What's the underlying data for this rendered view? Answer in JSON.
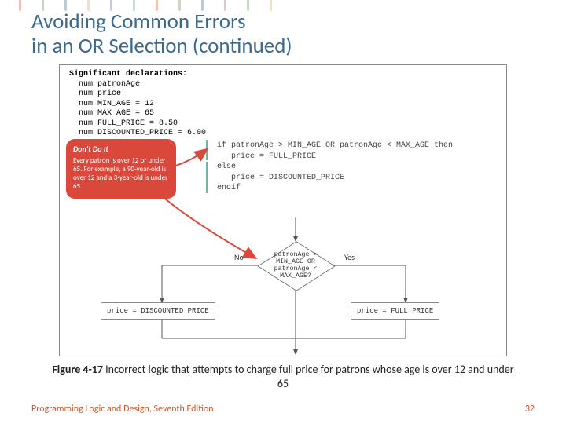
{
  "title_line1": "Avoiding Common Errors",
  "title_line2": "in an OR Selection (continued)",
  "decl": {
    "heading": "Significant declarations:",
    "l1": "num patronAge",
    "l2": "num price",
    "l3": "num MIN_AGE = 12",
    "l4": "num MAX_AGE = 65",
    "l5": "num FULL_PRICE = 8.50",
    "l6": "num DISCOUNTED_PRICE = 6.00"
  },
  "warn": {
    "heading": "Don't Do It",
    "body": "Every patron is over 12 or under 65. For example, a 90-year-old is over 12 and a 3-year-old is under 65."
  },
  "pseudo": {
    "l1": "if patronAge > MIN_AGE OR patronAge < MAX_AGE then",
    "l2": "   price = FULL_PRICE",
    "l3": "else",
    "l4": "   price = DISCOUNTED_PRICE",
    "l5": "endif"
  },
  "flow": {
    "diamond_l1": "patronAge >",
    "diamond_l2": "MIN_AGE OR",
    "diamond_l3": "patronAge <",
    "diamond_l4": "MAX_AGE?",
    "no": "No",
    "yes": "Yes",
    "box_left": "price = DISCOUNTED_PRICE",
    "box_right": "price = FULL_PRICE"
  },
  "caption_strong": "Figure 4-17",
  "caption_rest": " Incorrect logic that attempts to charge full price for patrons whose age is over 12 and under 65",
  "footer": "Programming Logic and Design, Seventh Edition",
  "page": "32",
  "stripes": [
    "#d9483b",
    "#5b8f49",
    "#3b6a8e",
    "#e6a23c",
    "#7c5ba6",
    "#4aa3a3",
    "#c45a2d",
    "#8a8a3a",
    "#3b6a8e",
    "#c94f7c",
    "#5b8f49",
    "#e6a23c"
  ]
}
